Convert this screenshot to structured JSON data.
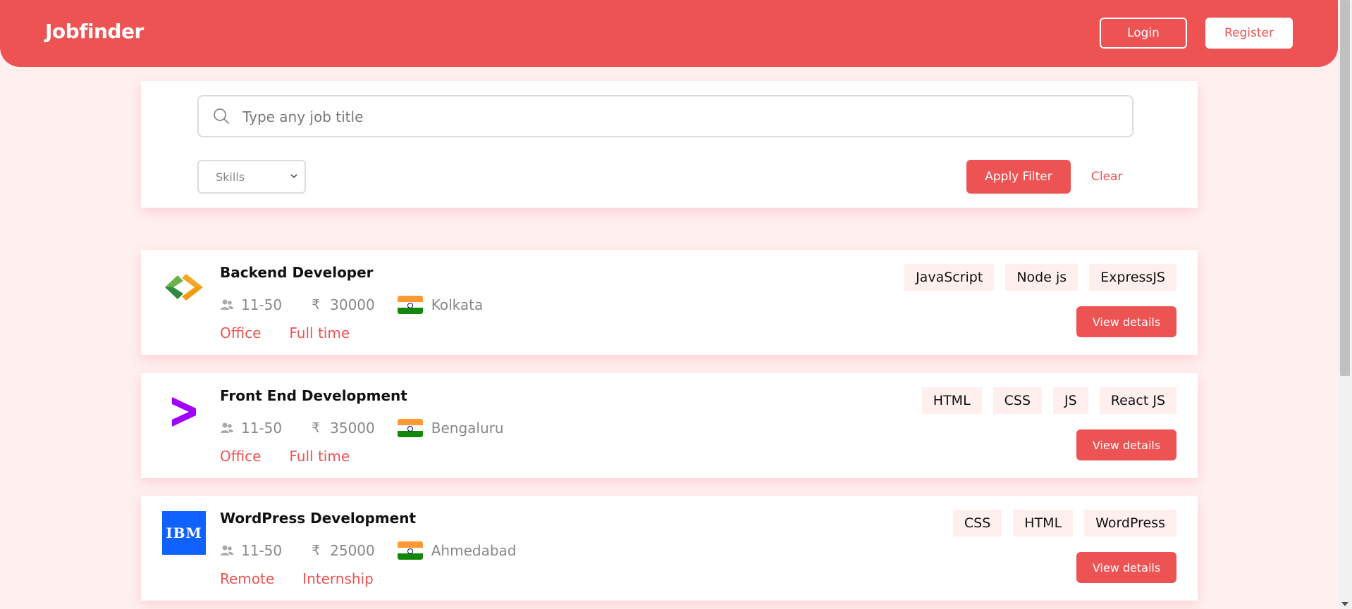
{
  "navbar": {
    "brand": "Jobfinder",
    "login_label": "Login",
    "register_label": "Register",
    "brand_color": "#ed5353"
  },
  "filter": {
    "search_placeholder": "Type any job title",
    "search_value": "",
    "skills_selected": "Skills",
    "apply_label": "Apply Filter",
    "clear_label": "Clear"
  },
  "jobs": [
    {
      "title": "Backend Developer",
      "company_size": "11-50",
      "currency_symbol": "₹",
      "salary": "30000",
      "location": "Kolkata",
      "work_mode": "Office",
      "job_type": "Full time",
      "skills": [
        "JavaScript",
        "Node js",
        "ExpressJS"
      ],
      "view_label": "View details",
      "logo_icon": "green-orange-chevron-logo"
    },
    {
      "title": "Front End Development",
      "company_size": "11-50",
      "currency_symbol": "₹",
      "salary": "35000",
      "location": "Bengaluru",
      "work_mode": "Office",
      "job_type": "Full time",
      "skills": [
        "HTML",
        "CSS",
        "JS",
        "React JS"
      ],
      "view_label": "View details",
      "logo_icon": "purple-chevron-logo"
    },
    {
      "title": "WordPress Development",
      "company_size": "11-50",
      "currency_symbol": "₹",
      "salary": "25000",
      "location": "Ahmedabad",
      "work_mode": "Remote",
      "job_type": "Internship",
      "skills": [
        "CSS",
        "HTML",
        "WordPress"
      ],
      "view_label": "View details",
      "logo_icon": "ibm-logo",
      "logo_text": "IBM"
    }
  ]
}
